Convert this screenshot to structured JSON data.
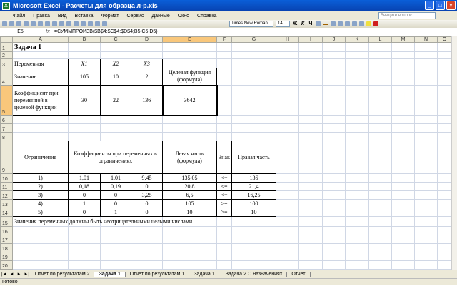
{
  "window": {
    "title": "Microsoft Excel - Расчеты для образца л-р.xls"
  },
  "menu": [
    "Файл",
    "Правка",
    "Вид",
    "Вставка",
    "Формат",
    "Сервис",
    "Данные",
    "Окно",
    "Справка"
  ],
  "ask_placeholder": "Введите вопрос",
  "toolbar": {
    "font": "Times New Roman",
    "size": "14",
    "bold": "Ж",
    "italic": "К",
    "underline": "Ч"
  },
  "formula_bar": {
    "cell": "E5",
    "fx": "fx",
    "formula": "=СУММПРОИЗВ($B$4:$C$4:$D$4;B5:C5:D5)"
  },
  "columns": [
    "A",
    "B",
    "C",
    "D",
    "E",
    "F",
    "G",
    "H",
    "I",
    "J",
    "K",
    "L",
    "M",
    "N",
    "O"
  ],
  "sheet": {
    "r1": "Задача 1",
    "r3": [
      "Переменная",
      "X1",
      "X2",
      "X3"
    ],
    "r4": [
      "Значение",
      "105",
      "10",
      "2",
      "Целевая функция (формула)"
    ],
    "r5": [
      "Коэффициент при переменной в целевой функции",
      "30",
      "22",
      "136",
      "3642"
    ],
    "r9": [
      "Ограничение",
      "Коэффициенты при переменных в ограничениях",
      "Левая часть (формула)",
      "Знак",
      "Правая часть"
    ],
    "constraints": [
      [
        "1)",
        "1,01",
        "1,01",
        "9,45",
        "135,05",
        "<=",
        "136"
      ],
      [
        "2)",
        "0,18",
        "0,19",
        "0",
        "20,8",
        "<=",
        "21,4"
      ],
      [
        "3)",
        "0",
        "0",
        "3,25",
        "6,5",
        "<=",
        "16,25"
      ],
      [
        "4)",
        "1",
        "0",
        "0",
        "105",
        ">=",
        "100"
      ],
      [
        "5)",
        "0",
        "1",
        "0",
        "10",
        ">=",
        "10"
      ]
    ],
    "r15": "Значения переменных должны быть неотрицательными целыми числами."
  },
  "tabs": [
    "Отчет по результатам 2",
    "Задача 1",
    "Отчет по результатам 1",
    "Задача 1.",
    "Задача 2 О назначениях",
    "Отчет"
  ],
  "active_tab": 1,
  "status": "Готово"
}
